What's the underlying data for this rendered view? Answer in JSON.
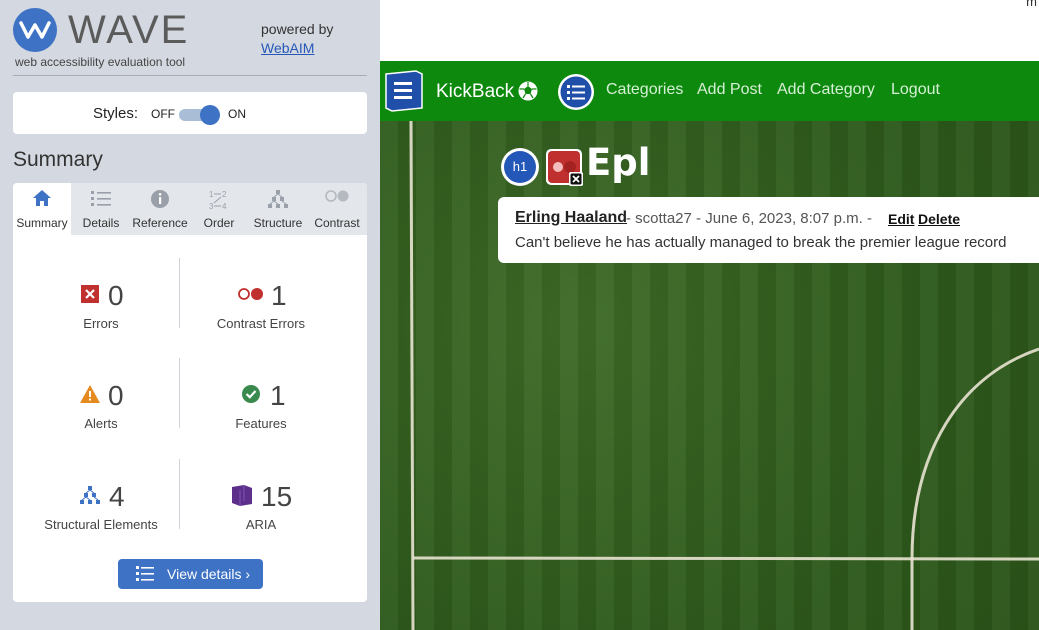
{
  "wave": {
    "logo_text": "WAVE",
    "tagline": "web accessibility evaluation tool",
    "powered_by": "powered by",
    "powered_link": "WebAIM",
    "styles_label": "Styles:",
    "styles_off": "OFF",
    "styles_on": "ON",
    "styles_enabled": true,
    "summary_heading": "Summary",
    "tabs": [
      {
        "label": "Summary",
        "icon": "home-icon",
        "active": true
      },
      {
        "label": "Details",
        "icon": "list-icon",
        "active": false
      },
      {
        "label": "Reference",
        "icon": "info-icon",
        "active": false
      },
      {
        "label": "Order",
        "icon": "order-icon",
        "active": false
      },
      {
        "label": "Structure",
        "icon": "structure-icon",
        "active": false
      },
      {
        "label": "Contrast",
        "icon": "contrast-icon",
        "active": false
      }
    ],
    "stats": {
      "errors": {
        "count": "0",
        "label": "Errors",
        "color": "#c0302f"
      },
      "contrast_errors": {
        "count": "1",
        "label": "Contrast Errors",
        "color": "#c0302f"
      },
      "alerts": {
        "count": "0",
        "label": "Alerts",
        "color": "#e58a1f"
      },
      "features": {
        "count": "1",
        "label": "Features",
        "color": "#3a8a4e"
      },
      "structural": {
        "count": "4",
        "label": "Structural Elements",
        "color": "#3d72c4"
      },
      "aria": {
        "count": "15",
        "label": "ARIA",
        "color": "#5b2f8a"
      }
    },
    "view_details": "View details ›",
    "accent": "#3d72c4"
  },
  "page": {
    "corner_text": "m",
    "nav": {
      "brand": "KickBack",
      "links": [
        "Categories",
        "Add Post",
        "Add Category",
        "Logout"
      ],
      "background": "#0d8a0d"
    },
    "heading": "Epl",
    "post": {
      "title": "Erling Haaland",
      "meta": "- scotta27 - June 6, 2023, 8:07 p.m. -",
      "edit": "Edit",
      "delete": "Delete",
      "body": "Can't believe he has actually managed to break the premier league record"
    }
  }
}
